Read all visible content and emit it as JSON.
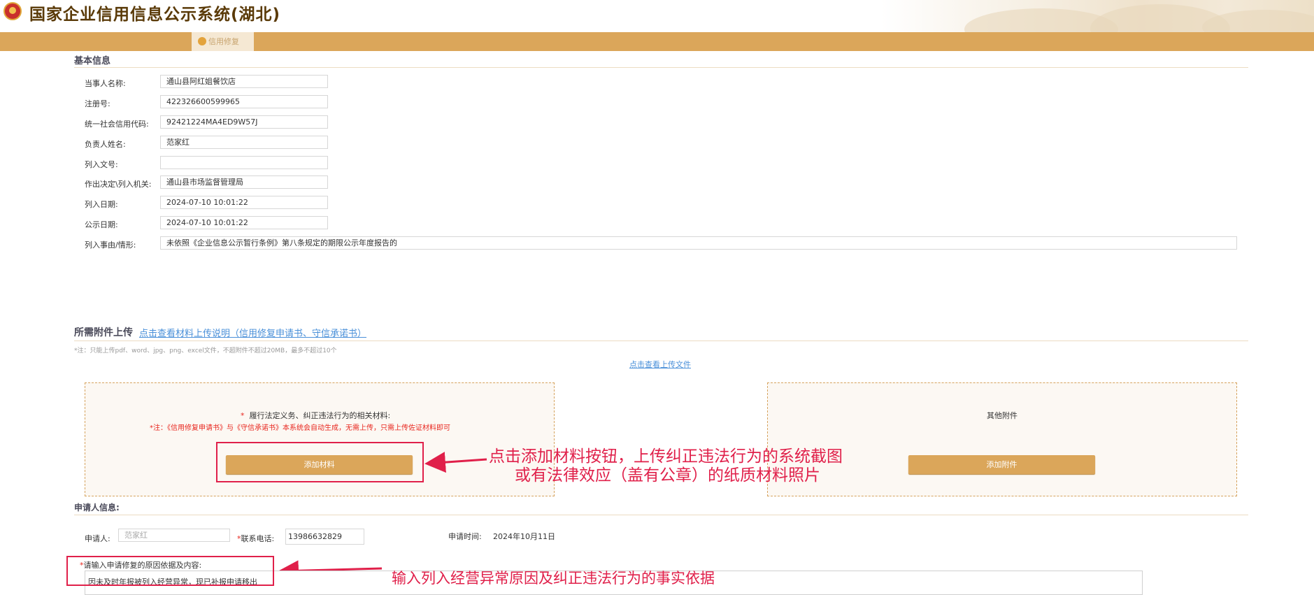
{
  "header": {
    "site_title": "国家企业信用信息公示系统(湖北)",
    "active_tab": "信用修复"
  },
  "basic_info": {
    "title": "基本信息",
    "fields": [
      {
        "label": "当事人名称:",
        "value": "通山县阿红姐餐饮店"
      },
      {
        "label": "注册号:",
        "value": "422326600599965"
      },
      {
        "label": "统一社会信用代码:",
        "value": "92421224MA4ED9W57J"
      },
      {
        "label": "负责人姓名:",
        "value": "范家红"
      },
      {
        "label": "列入文号:",
        "value": ""
      },
      {
        "label": "作出决定\\列入机关:",
        "value": "通山县市场监督管理局"
      },
      {
        "label": "列入日期:",
        "value": "2024-07-10 10:01:22"
      },
      {
        "label": "公示日期:",
        "value": "2024-07-10 10:01:22"
      },
      {
        "label": "列入事由/情形:",
        "value": "未依照《企业信息公示暂行条例》第八条规定的期限公示年度报告的"
      }
    ]
  },
  "attachments": {
    "title": "所需附件上传",
    "instructions_link": "点击查看材料上传说明（信用修复申请书、守信承诺书）",
    "note": "*注：只能上传pdf、word、jpg、png、excel文件，不超附件不超过20MB，最多不超过10个",
    "view_uploaded_link": "点击查看上传文件",
    "left_box": {
      "required_mark": "*",
      "heading": "履行法定义务、纠正违法行为的相关材料:",
      "note": "*注：《信用修复申请书》与《守信承诺书》本系统会自动生成，无需上传，只需上传佐证材料即可",
      "button": "添加材料"
    },
    "right_box": {
      "heading": "其他附件",
      "button": "添加附件"
    }
  },
  "applicant": {
    "title": "申请人信息:",
    "applicant_label": "申请人:",
    "applicant_placeholder": "范家红",
    "phone_label": "联系电话:",
    "phone_value": "13986632829",
    "time_label": "申请时间:",
    "time_value": "2024年10月11日",
    "reason_label": "请输入申请修复的原因依据及内容:",
    "reason_value": "因未及时年报被列入经营异常，现已补报申请移出",
    "required_mark": "*"
  },
  "annotations": {
    "upload_line1": "点击添加材料按钮，上传纠正违法行为的系统截图",
    "upload_line2": "或有法律效应（盖有公章）的纸质材料照片",
    "reason_hint": "输入列入经营异常原因及纠正违法行为的事实依据"
  },
  "colors": {
    "brand": "#dba65a",
    "annotation": "#e0204a",
    "link": "#4a90d9"
  }
}
